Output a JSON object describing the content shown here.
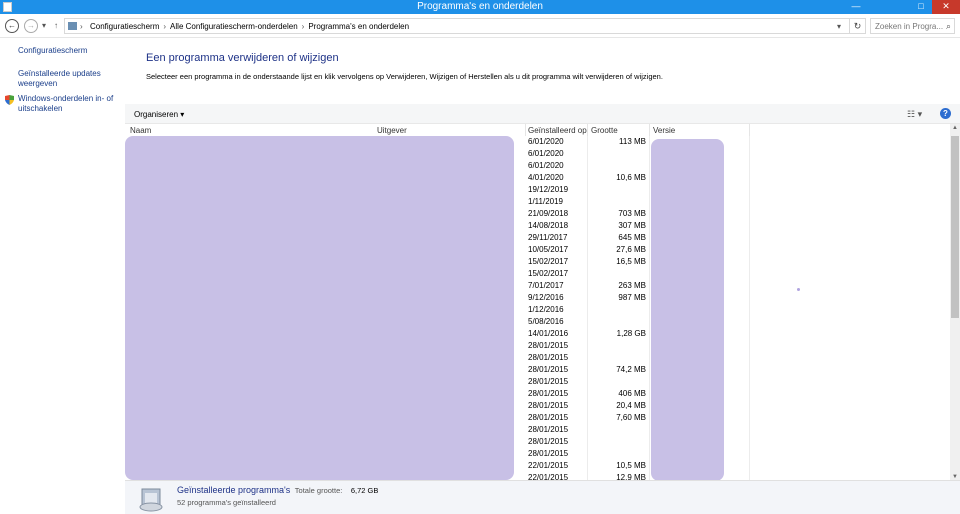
{
  "window": {
    "title": "Programma's en onderdelen",
    "min": "—",
    "max": "□",
    "close": "✕"
  },
  "address": {
    "crumbs": [
      "Configuratiescherm",
      "Alle Configuratiescherm-onderdelen",
      "Programma's en onderdelen"
    ],
    "search_placeholder": "Zoeken in Progra...",
    "back_glyph": "←",
    "forward_glyph": "→",
    "up_glyph": "↑",
    "refresh_glyph": "↻",
    "search_glyph": "⌕"
  },
  "sidebar": {
    "items": [
      {
        "label": "Configuratiescherm"
      },
      {
        "label": "Geïnstalleerde updates weergeven"
      },
      {
        "label": "Windows-onderdelen in- of uitschakelen",
        "icon": "shield-icon"
      }
    ]
  },
  "main": {
    "heading": "Een programma verwijderen of wijzigen",
    "description": "Selecteer een programma in de onderstaande lijst en klik vervolgens op Verwijderen, Wijzigen of Herstellen als u dit programma wilt verwijderen of wijzigen."
  },
  "toolbar": {
    "organize": "Organiseren",
    "dropdown_glyph": "▾",
    "view_glyph": "☷ ▾",
    "help_glyph": "?"
  },
  "columns": {
    "name": "Naam",
    "publisher": "Uitgever",
    "installed_on": "Geïnstalleerd op",
    "size": "Grootte",
    "version": "Versie"
  },
  "rows": [
    {
      "date": "6/01/2020",
      "size": "113 MB"
    },
    {
      "date": "6/01/2020",
      "size": ""
    },
    {
      "date": "6/01/2020",
      "size": ""
    },
    {
      "date": "4/01/2020",
      "size": "10,6 MB"
    },
    {
      "date": "19/12/2019",
      "size": ""
    },
    {
      "date": "1/11/2019",
      "size": ""
    },
    {
      "date": "21/09/2018",
      "size": "703 MB"
    },
    {
      "date": "14/08/2018",
      "size": "307 MB"
    },
    {
      "date": "29/11/2017",
      "size": "645 MB"
    },
    {
      "date": "10/05/2017",
      "size": "27,6 MB"
    },
    {
      "date": "15/02/2017",
      "size": "16,5 MB"
    },
    {
      "date": "15/02/2017",
      "size": ""
    },
    {
      "date": "7/01/2017",
      "size": "263 MB"
    },
    {
      "date": "9/12/2016",
      "size": "987 MB"
    },
    {
      "date": "1/12/2016",
      "size": ""
    },
    {
      "date": "5/08/2016",
      "size": ""
    },
    {
      "date": "14/01/2016",
      "size": "1,28 GB"
    },
    {
      "date": "28/01/2015",
      "size": ""
    },
    {
      "date": "28/01/2015",
      "size": ""
    },
    {
      "date": "28/01/2015",
      "size": "74,2 MB"
    },
    {
      "date": "28/01/2015",
      "size": ""
    },
    {
      "date": "28/01/2015",
      "size": "406 MB"
    },
    {
      "date": "28/01/2015",
      "size": "20,4 MB"
    },
    {
      "date": "28/01/2015",
      "size": "7,60 MB"
    },
    {
      "date": "28/01/2015",
      "size": ""
    },
    {
      "date": "28/01/2015",
      "size": ""
    },
    {
      "date": "28/01/2015",
      "size": ""
    },
    {
      "date": "22/01/2015",
      "size": "10,5 MB"
    },
    {
      "date": "22/01/2015",
      "size": "12,9 MB"
    }
  ],
  "footer": {
    "title": "Geïnstalleerde programma's",
    "total_label": "Totale grootte:",
    "total_value": "6,72 GB",
    "count": "52 programma's geïnstalleerd"
  },
  "colors": {
    "titlebar": "#1e90e8",
    "link": "#1a3e8a",
    "heading": "#1e3287",
    "redaction": "#c8c0e6"
  }
}
